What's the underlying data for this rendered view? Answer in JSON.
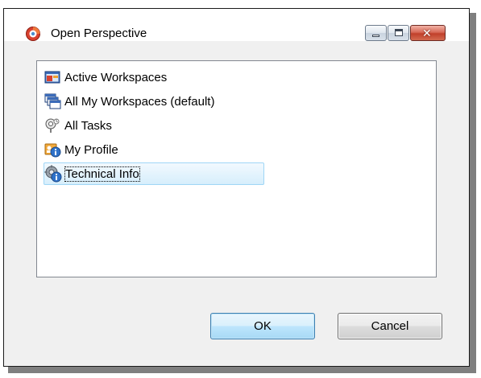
{
  "dialog": {
    "title": "Open Perspective",
    "app_icon": "perspective-app-icon",
    "controls": {
      "minimize_icon": "minimize-icon",
      "maximize_icon": "maximize-icon",
      "close_icon": "close-icon",
      "close_glyph": "✕"
    }
  },
  "perspectives": [
    {
      "label": "Active Workspaces",
      "icon": "active-workspaces-icon",
      "selected": false
    },
    {
      "label": "All My Workspaces (default)",
      "icon": "all-workspaces-icon",
      "selected": false
    },
    {
      "label": "All Tasks",
      "icon": "tasks-icon",
      "selected": false
    },
    {
      "label": "My Profile",
      "icon": "profile-icon",
      "selected": false
    },
    {
      "label": "Technical Info",
      "icon": "technical-info-icon",
      "selected": true
    }
  ],
  "buttons": {
    "ok": "OK",
    "cancel": "Cancel"
  },
  "colors": {
    "selection_fill": "#d6eefc",
    "selection_border": "#9fd6f6",
    "default_button_border": "#3c7fb1",
    "close_button": "#c1402b"
  }
}
